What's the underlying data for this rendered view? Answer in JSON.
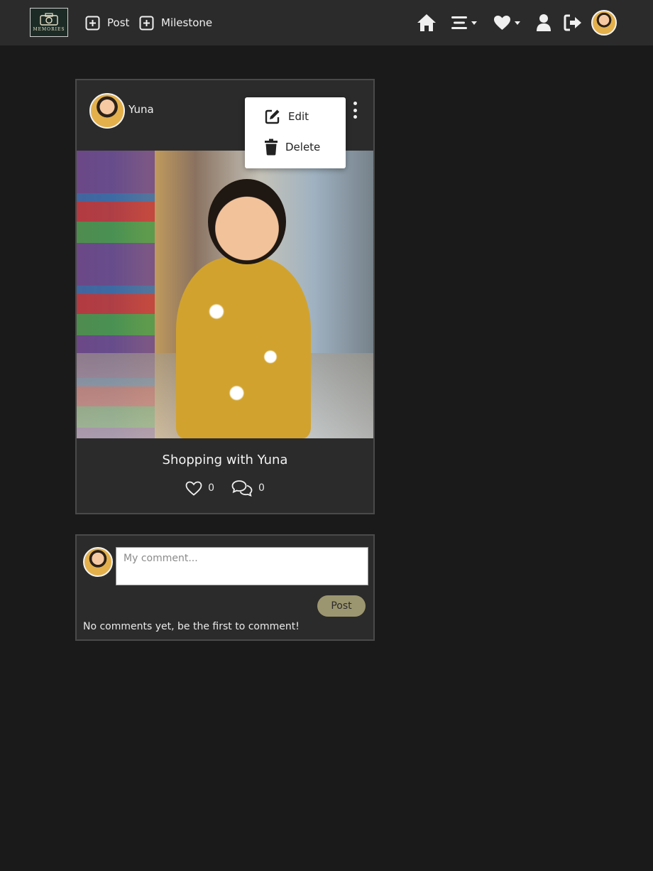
{
  "navbar": {
    "logo_text": "MEMORIES",
    "post_label": "Post",
    "milestone_label": "Milestone",
    "icons": [
      "home-icon",
      "menu-icon",
      "heart-icon",
      "user-icon",
      "logout-icon"
    ]
  },
  "post": {
    "username": "Yuna",
    "title": "Shopping with Yuna",
    "likes": "0",
    "comments": "0",
    "menu": {
      "edit_label": "Edit",
      "delete_label": "Delete"
    }
  },
  "comment_box": {
    "placeholder": "My comment...",
    "post_label": "Post",
    "empty_message": "No comments yet, be the first to comment!"
  },
  "colors": {
    "background": "#1a1a1a",
    "card": "#2b2b2b",
    "post_button": "#9c9670"
  }
}
